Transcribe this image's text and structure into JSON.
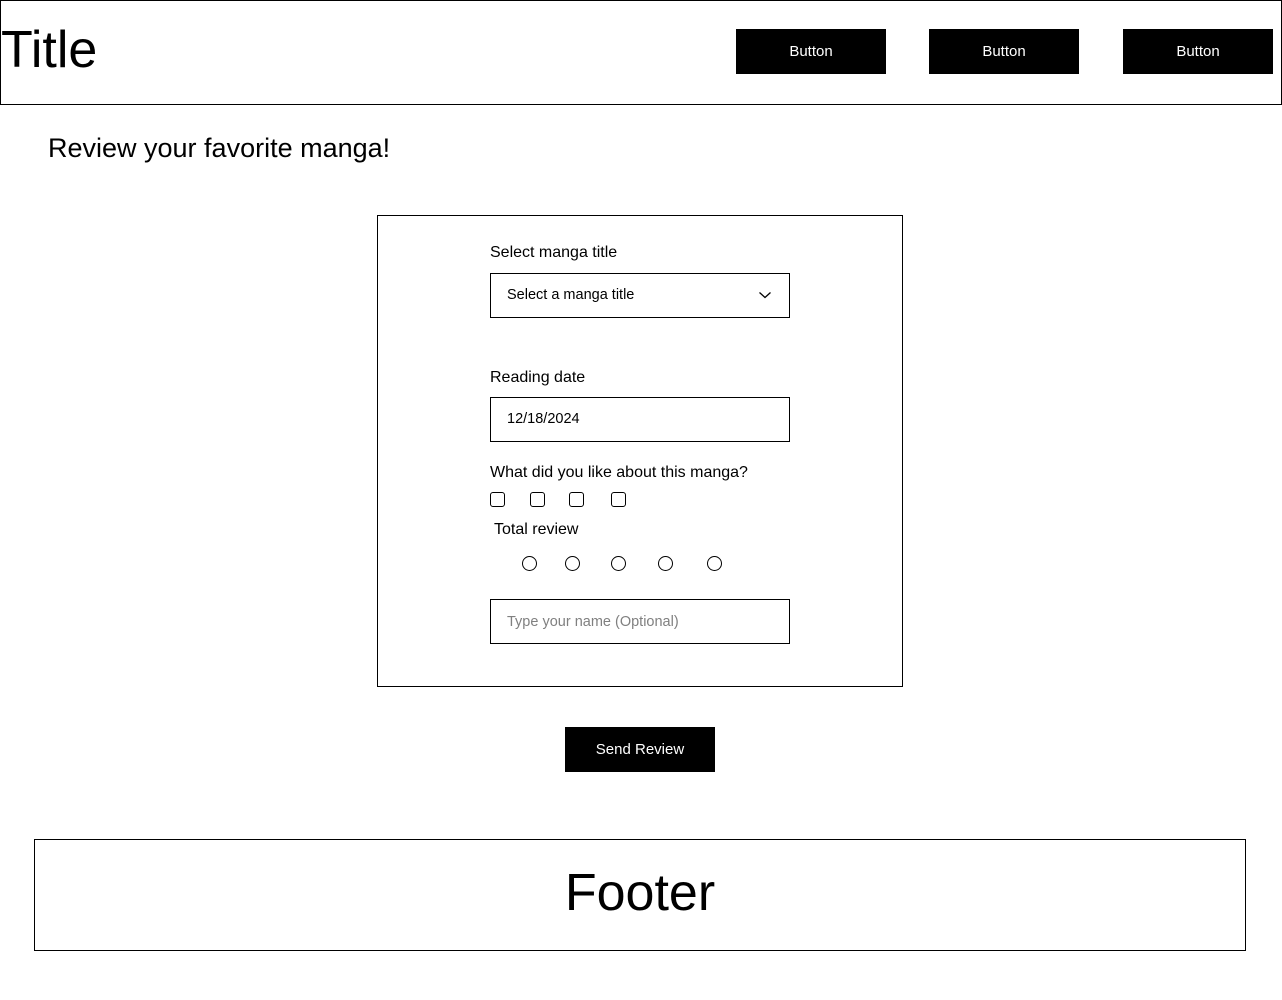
{
  "header": {
    "title": "Title",
    "buttons": [
      "Button",
      "Button",
      "Button"
    ]
  },
  "page": {
    "heading": "Review your favorite manga!"
  },
  "form": {
    "manga_label": "Select manga title",
    "manga_select_value": "Select a manga title",
    "date_label": "Reading date",
    "date_value": "12/18/2024",
    "like_label": "What did you like about this manga?",
    "like_checkbox_count": 4,
    "total_label": "Total review",
    "total_radio_count": 5,
    "name_placeholder": "Type your name (Optional)",
    "name_value": ""
  },
  "actions": {
    "send_label": "Send Review"
  },
  "footer": {
    "text": "Footer"
  },
  "colors": {
    "button_bg": "#000000",
    "button_text": "#ffffff",
    "border": "#000000",
    "placeholder": "#808080"
  },
  "icons": {
    "select": "chevron-down-icon"
  }
}
